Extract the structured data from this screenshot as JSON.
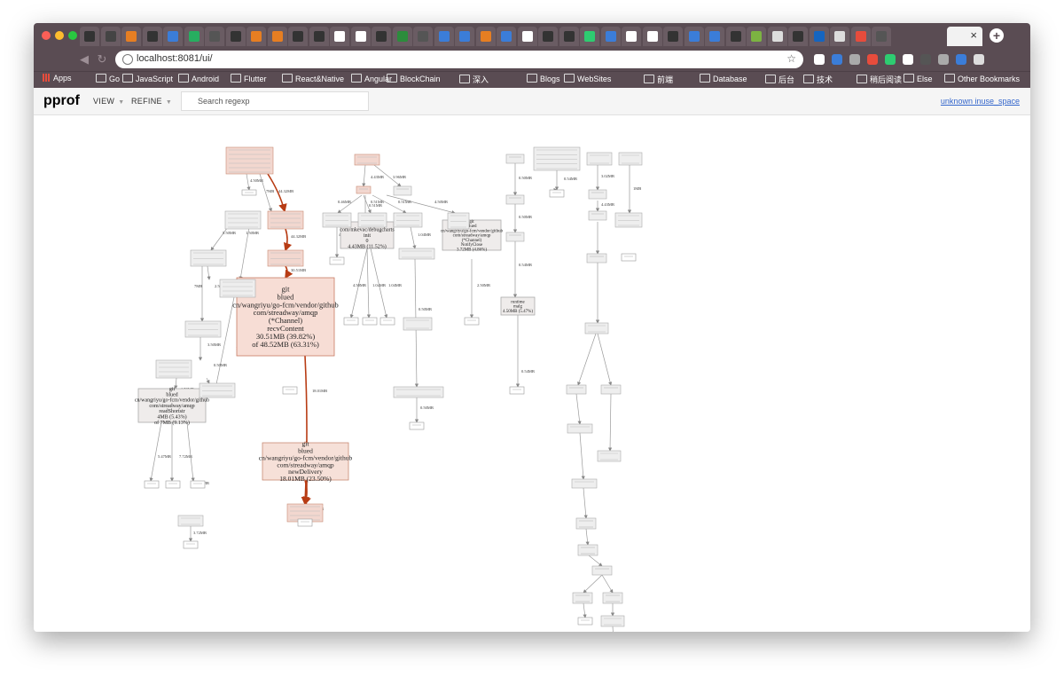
{
  "browser": {
    "url": "localhost:8081/ui/",
    "bookmarks": [
      "Apps",
      "Go",
      "JavaScript",
      "Android",
      "Flutter",
      "React&Native",
      "Angular",
      "BlockChain",
      "深入",
      "Blogs",
      "WebSites",
      "前端",
      "Database",
      "后台",
      "技术",
      "稍后阅读",
      "Else"
    ],
    "other_bookmarks": "Other Bookmarks"
  },
  "pprof": {
    "logo": "pprof",
    "menu_view": "VIEW",
    "menu_refine": "REFINE",
    "search_placeholder": "Search regexp",
    "sample_type": "unknown inuse_space"
  },
  "graph": {
    "nodes": {
      "recvContent": [
        "git",
        "blued",
        "cn/wangriyu/go-fcm/vendor/github",
        "com/streadway/amqp",
        "(*Channel)",
        "recvContent",
        "30.51MB (39.82%)",
        "of 48.52MB (63.31%)"
      ],
      "newDelivery": [
        "git",
        "blued",
        "cn/wangriyu/go-fcm/vendor/github",
        "com/streadway/amqp",
        "newDelivery",
        "18.01MB (23.50%)"
      ],
      "readShortstr": [
        "git",
        "blued",
        "cn/wangriyu/go-fcm/vendor/github",
        "com/streadway/amqp",
        "readShortstr",
        "4MB (5.43%)",
        "of 7MB (9.13%)"
      ],
      "debugcharts": [
        "github",
        "com/mkevac/debugcharts",
        "init",
        "0",
        "4.43MB (11.52%)"
      ],
      "channelNotifyClose": [
        "git",
        "blued",
        "cn/wangriyu/go-fcm/vendor/github",
        "com/streadway/amqp",
        "(*Channel)",
        "NotifyClose",
        "3.72MB (4.86%)"
      ],
      "runtimeMalg": [
        "runtime",
        "malg",
        "4.50MB (5.47%)"
      ]
    },
    "edges": {
      "e1": "4.50MB",
      "e2": "7MB",
      "e3": "44.32MB",
      "e4": "5.50MB",
      "e5": "1.50MB",
      "e6": "44.32MB",
      "e7": "30.51MB",
      "e8": "18.01MB",
      "e9": "18.01MB",
      "e10": "18.01MB",
      "e11": "7MB",
      "e12": "2.50MB",
      "e13": "1MB",
      "e14": "3.50MB",
      "e15": "0.50MB",
      "e16": "1.50MB",
      "e17": "5.47MB",
      "e18": "7.72MB",
      "e19": "3.72MB",
      "e20": "3.72MB",
      "e21": "4.43MB",
      "e22": "3.96MB",
      "e23": "0.46MB",
      "e24": "0.51MB",
      "e25": "0.51MB",
      "e26": "0.51MB",
      "e27": "4.50MB",
      "e28": "4.50MB",
      "e29": "4.50MB",
      "e30": "1.04MB",
      "e31": "1.04MB",
      "e32": "1.04MB",
      "e33": "0.50MB",
      "e34": "0.50MB",
      "e35": "0.50MB",
      "e36": "2.50MB",
      "e37": "0.50MB",
      "e38": "0.50MB",
      "e39": "0.54MB",
      "e40": "0.54MB",
      "e41": "0.54MB",
      "e42": "3.02MB",
      "e43": "1MB",
      "e44": "4.43MB"
    }
  }
}
